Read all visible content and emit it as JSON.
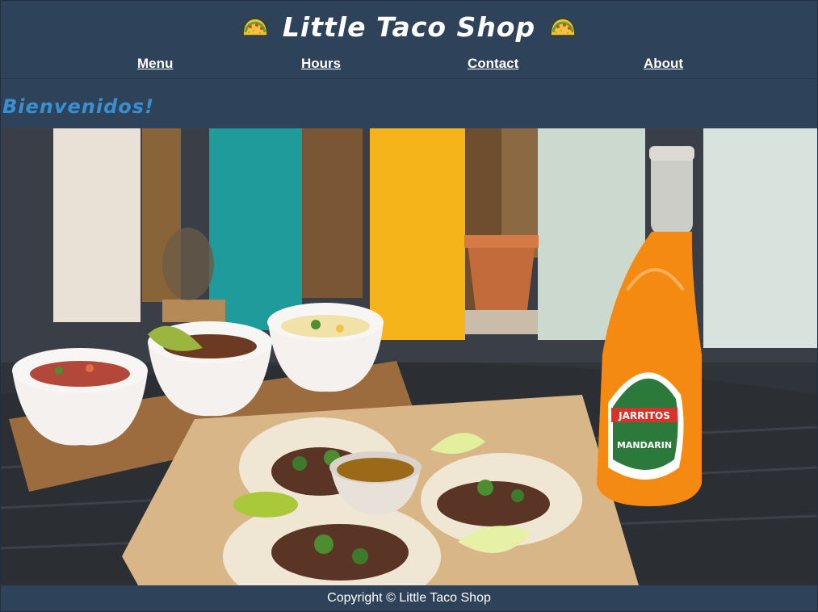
{
  "header": {
    "title": "Little Taco Shop",
    "icon_left": "taco-icon",
    "icon_right": "taco-icon"
  },
  "nav": {
    "items": [
      {
        "label": "Menu"
      },
      {
        "label": "Hours"
      },
      {
        "label": "Contact"
      },
      {
        "label": "About"
      }
    ]
  },
  "main": {
    "subtitle": "Bienvenidos!",
    "hero_image": "tacos-salsas-and-jarritos-photo",
    "bottle_label": "JARRITOS",
    "bottle_flavor": "MANDARIN"
  },
  "footer": {
    "copyright": "Copyright © Little Taco Shop"
  },
  "colors": {
    "background": "#2e4359",
    "subtitle": "#3a8fd1",
    "text": "#ffffff"
  }
}
